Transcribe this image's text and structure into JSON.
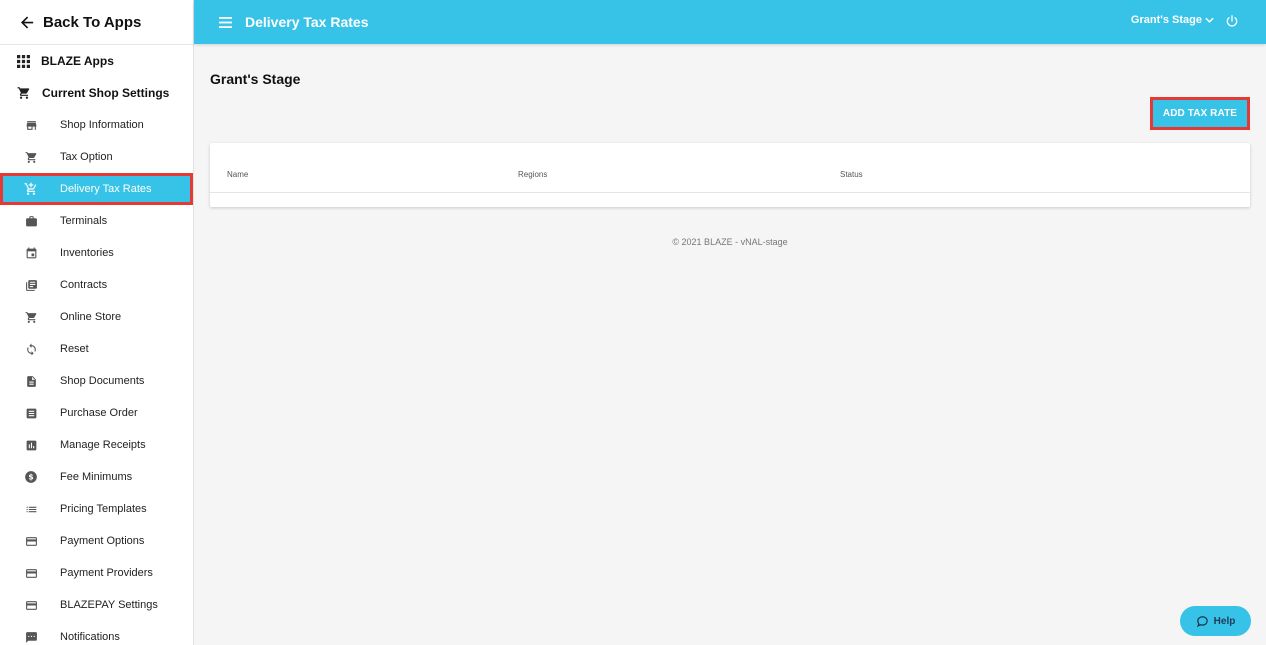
{
  "sidebar": {
    "back_label": "Back To Apps",
    "apps_label": "BLAZE Apps",
    "settings_label": "Current Shop Settings",
    "items": [
      {
        "label": "Shop Information",
        "icon": "store-icon"
      },
      {
        "label": "Tax Option",
        "icon": "cart-icon"
      },
      {
        "label": "Delivery Tax Rates",
        "icon": "cart-plus-icon",
        "active": true
      },
      {
        "label": "Terminals",
        "icon": "briefcase-icon"
      },
      {
        "label": "Inventories",
        "icon": "calendar-icon"
      },
      {
        "label": "Contracts",
        "icon": "library-books-icon"
      },
      {
        "label": "Online Store",
        "icon": "cart-icon"
      },
      {
        "label": "Reset",
        "icon": "refresh-icon"
      },
      {
        "label": "Shop Documents",
        "icon": "document-icon"
      },
      {
        "label": "Purchase Order",
        "icon": "list-box-icon"
      },
      {
        "label": "Manage Receipts",
        "icon": "bar-chart-icon"
      },
      {
        "label": "Fee Minimums",
        "icon": "dollar-icon"
      },
      {
        "label": "Pricing Templates",
        "icon": "list-icon"
      },
      {
        "label": "Payment Options",
        "icon": "credit-card-icon"
      },
      {
        "label": "Payment Providers",
        "icon": "credit-card-icon"
      },
      {
        "label": "BLAZEPAY Settings",
        "icon": "credit-card-icon"
      },
      {
        "label": "Notifications",
        "icon": "comment-icon"
      }
    ]
  },
  "header": {
    "title": "Delivery Tax Rates",
    "store": "Grant's Stage"
  },
  "main": {
    "shop_title": "Grant's Stage",
    "add_button": "ADD TAX RATE",
    "columns": [
      "Name",
      "Regions",
      "Status"
    ],
    "footer": "© 2021 BLAZE - vNAL-stage"
  },
  "help_label": "Help",
  "colors": {
    "accent": "#37c3e7",
    "highlight": "#e53935"
  }
}
